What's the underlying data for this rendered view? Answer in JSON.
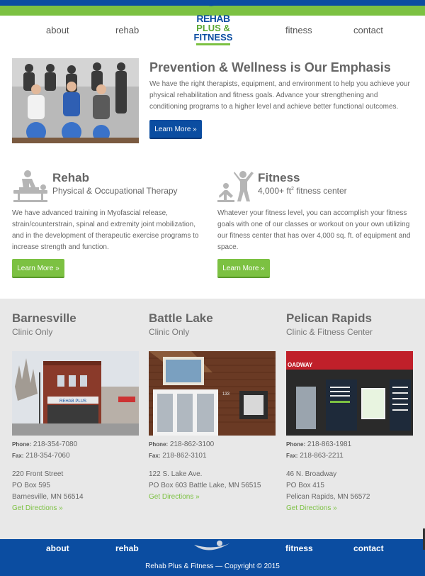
{
  "nav": {
    "about": "about",
    "rehab": "rehab",
    "fitness": "fitness",
    "contact": "contact"
  },
  "logo": {
    "line1": "REHAB",
    "line2": "PLUS &",
    "line3": "FITNESS"
  },
  "hero": {
    "title": "Prevention & Wellness is Our Emphasis",
    "text": "We have the right therapists, equipment, and environment to help you achieve your physical rehabilitation and fitness goals. Advance your strengthening and conditioning programs to a higher level and achieve better functional outcomes.",
    "button": "Learn More »"
  },
  "services": [
    {
      "title": "Rehab",
      "subtitle": "Physical & Occupational Therapy",
      "text": "We have advanced training in Myofascial release, strain/counterstrain, spinal and extremity joint mobilization, and in the development of therapeutic exercise programs to increase strength and function.",
      "button": "Learn More »",
      "icon": "massage-table-icon"
    },
    {
      "title": "Fitness",
      "subtitle_pre": "4,000+ ft",
      "subtitle_sup": "2",
      "subtitle_post": " fitness center",
      "text": "Whatever your fitness level, you can accomplish your fitness goals with one of our classes or workout on your own utilizing our fitness center that has over 4,000 sq. ft. of equipment and space.",
      "button": "Learn More »",
      "icon": "exercise-figures-icon"
    }
  ],
  "locations": [
    {
      "name": "Barnesville",
      "type": "Clinic Only",
      "phone_label": "Phone:",
      "phone": "218-354-7080",
      "fax_label": "Fax:",
      "fax": "218-354-7060",
      "addr1": "220 Front Street",
      "addr2": "PO Box 595",
      "addr3": "Barnesville, MN 56514",
      "directions": "Get Directions »",
      "sign": "REHAB PLUS"
    },
    {
      "name": "Battle Lake",
      "type": "Clinic Only",
      "phone_label": "Phone:",
      "phone": "218-862-3100",
      "fax_label": "Fax:",
      "fax": "218-862-3101",
      "addr1": "122 S. Lake Ave.",
      "addr2": "PO Box 603 Battle Lake, MN 56515",
      "addr3": "",
      "directions": "Get Directions »",
      "sign": "133"
    },
    {
      "name": "Pelican Rapids",
      "type": "Clinic & Fitness Center",
      "phone_label": "Phone:",
      "phone": "218-863-1981",
      "fax_label": "Fax:",
      "fax": "218-863-2211",
      "addr1": "46 N. Broadway",
      "addr2": "PO Box 415",
      "addr3": "Pelican Rapids, MN 56572",
      "directions": "Get Directions »",
      "sign": "OADWAY"
    }
  ],
  "footer": {
    "about": "about",
    "rehab": "rehab",
    "fitness": "fitness",
    "contact": "contact",
    "copyright": "Rehab Plus & Fitness — Copyright © 2015"
  },
  "colors": {
    "brand_blue": "#0b4da1",
    "brand_green": "#7cc142",
    "section_gray": "#e8e8e8"
  }
}
